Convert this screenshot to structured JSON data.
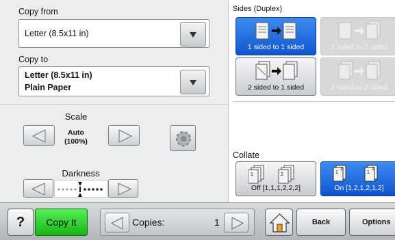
{
  "copy_from": {
    "label": "Copy from",
    "value": "Letter (8.5x11 in)"
  },
  "copy_to": {
    "label": "Copy to",
    "line1": "Letter (8.5x11 in)",
    "line2": "Plain Paper"
  },
  "scale": {
    "label": "Scale",
    "value_line1": "Auto",
    "value_line2": "(100%)"
  },
  "darkness": {
    "label": "Darkness",
    "level": 5,
    "levels": 9
  },
  "sides": {
    "label": "Sides (Duplex)",
    "options": [
      {
        "label": "1 sided to 1 sided",
        "state": "selected"
      },
      {
        "label": "1 sided to 2 sided",
        "state": "disabled"
      },
      {
        "label": "2 sided to 1 sided",
        "state": "normal"
      },
      {
        "label": "2 sided to 2 sided",
        "state": "disabled"
      }
    ]
  },
  "collate": {
    "label": "Collate",
    "off_label": "Off [1,1,1,2,2,2]",
    "on_label": "On [1,2,1,2,1,2]",
    "selected": "on"
  },
  "bottom": {
    "help": "?",
    "copy_it": "Copy It",
    "copies_label": "Copies:",
    "copies_value": "1",
    "back": "Back",
    "options": "Options"
  },
  "colors": {
    "selected_blue": "#1a64dc",
    "copy_it_green": "#2ccf2c",
    "panel_gray": "#eceded"
  }
}
